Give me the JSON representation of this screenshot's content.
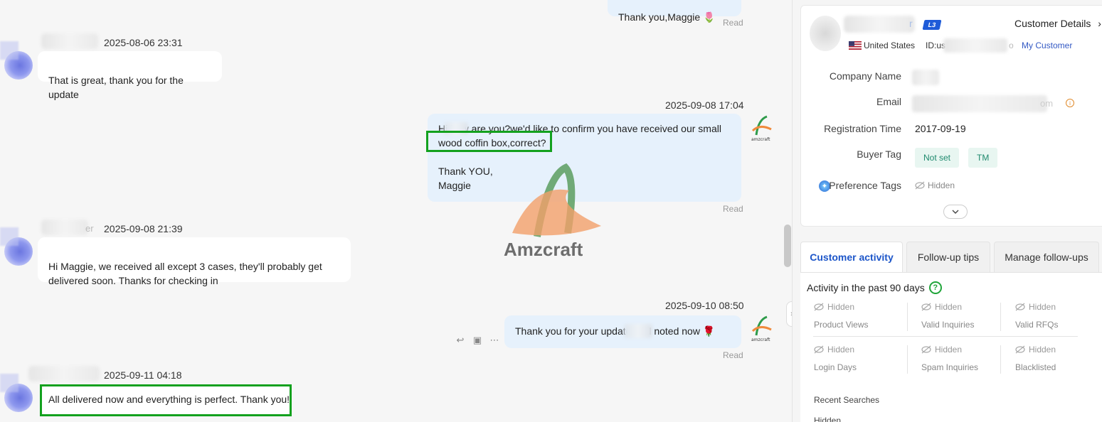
{
  "chat": {
    "messages": [
      {
        "direction": "out",
        "text": "Thank you,Maggie 🌷",
        "status": "Read"
      },
      {
        "direction": "in",
        "timestamp": "2025-08-06 23:31",
        "text": "That is great, thank you for the update"
      },
      {
        "direction": "out",
        "timestamp": "2025-09-08 17:04",
        "text_line1": "Hi      how are you?we'd like to confirm you have received our small",
        "text_line2": "wood coffin box,correct?",
        "text_line3": "Thank YOU,",
        "text_line4": "Maggie",
        "status": "Read",
        "highlighted_fragment": "wood coffin box,correct?"
      },
      {
        "direction": "in",
        "timestamp": "2025-09-08 21:39",
        "name_fragment": "er",
        "text": "Hi Maggie, we received all except 3 cases, they'll probably get delivered soon. Thanks for checking in"
      },
      {
        "direction": "out",
        "timestamp": "2025-09-10 08:50",
        "text": "Thank you for your update       well noted now 🌹",
        "status": "Read"
      },
      {
        "direction": "in",
        "timestamp": "2025-09-11 04:18",
        "text": "All delivered now and everything is perfect. Thank you!",
        "highlighted": true
      }
    ],
    "watermark_text": "Amzcraft",
    "seller_logo_text": "amzcraft"
  },
  "customer": {
    "level_badge": "L3",
    "details_link": "Customer Details",
    "country": "United States",
    "id_label": "ID:us",
    "id_suffix": "o",
    "my_customer": "My Customer",
    "name_suffix": "r",
    "fields": {
      "company_label": "Company Name",
      "email_label": "Email",
      "email_suffix": "om",
      "registration_label": "Registration Time",
      "registration_value": "2017-09-19",
      "buyer_tag_label": "Buyer Tag",
      "buyer_tags": [
        "Not set",
        "TM"
      ],
      "preference_label": "Preference Tags",
      "preference_value": "Hidden"
    }
  },
  "tabs": [
    "Customer activity",
    "Follow-up tips",
    "Manage follow-ups"
  ],
  "activity": {
    "title": "Activity in the past 90 days",
    "stats": [
      {
        "value": "Hidden",
        "label": "Product Views"
      },
      {
        "value": "Hidden",
        "label": "Valid Inquiries"
      },
      {
        "value": "Hidden",
        "label": "Valid RFQs"
      },
      {
        "value": "Hidden",
        "label": "Login Days"
      },
      {
        "value": "Hidden",
        "label": "Spam Inquiries"
      },
      {
        "value": "Hidden",
        "label": "Blacklisted"
      }
    ],
    "recent_searches_label": "Recent Searches",
    "recent_searches_value": "Hidden"
  },
  "colors": {
    "highlight": "#13a11e",
    "accent_blue": "#1d56c9",
    "out_bubble": "#e6f1fc"
  }
}
